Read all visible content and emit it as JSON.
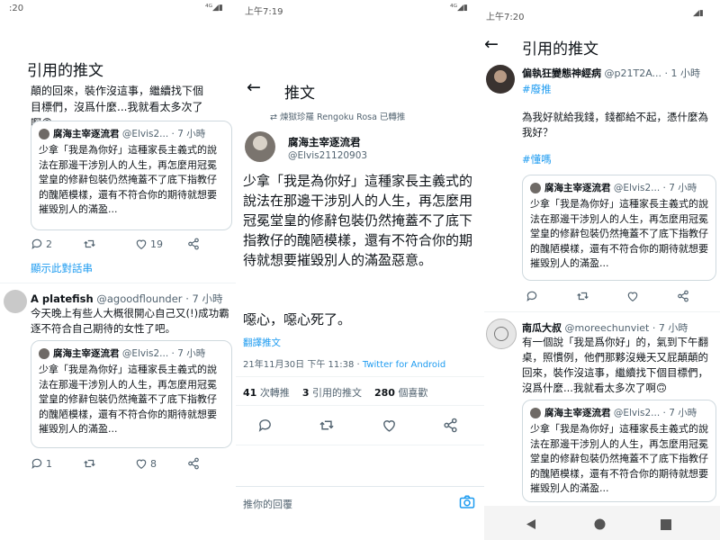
{
  "quote": {
    "name": "腐海主宰逐流君",
    "handle_short": "@Elvis2...",
    "time": "7 小時",
    "text": "少拿「我是為你好」這種家長主義式的說法在那邊干涉別人的人生，再怎麼用冠冕堂皇的修辭包裝仍然掩蓋不了底下指教仔的醜陋模樣，還有不符合你的期待就想要摧毀別人的滿盈..."
  },
  "panel1": {
    "status_time": ":20",
    "header": "引用的推文",
    "top_text": "顛的回來，裝作沒這事，繼續找下個目標們，沒爲什麼...我就看太多次了啊🙃",
    "top_actions": {
      "reply": "2",
      "retweet": "",
      "like": "19"
    },
    "show_thread": "顯示此對話串",
    "tweet2": {
      "name": "A platefish",
      "handle": "@agoodflounder",
      "time": "7 小時",
      "text": "今天晚上有些人大概很開心自己又(!)成功霸逐不符合自己期待的女性了吧。"
    },
    "bottom_actions": {
      "reply": "1",
      "retweet": "",
      "like": "8"
    }
  },
  "panel2": {
    "status_time": "上午7:19",
    "header": "推文",
    "retweeted_by": "煉獄珍羅 Rengoku Rosa 已轉推",
    "name": "腐海主宰逐流君",
    "handle": "@Elvis21120903",
    "text": "少拿「我是為你好」這種家長主義式的說法在那邊干涉別人的人生，再怎麼用冠冕堂皇的修辭包裝仍然掩蓋不了底下指教仔的醜陋模樣，還有不符合你的期待就想要摧毀別人的滿盈惡意。",
    "text2": "噁心，噁心死了。",
    "translate": "翻譯推文",
    "timestamp": "21年11月30日 下午 11:38 · ",
    "source": "Twitter for Android",
    "stats": {
      "retweets_num": "41",
      "retweets_label": "次轉推",
      "quotes_num": "3",
      "quotes_label": "引用的推文",
      "likes_num": "280",
      "likes_label": "個喜歡"
    },
    "reply_placeholder": "推你的回覆"
  },
  "panel3": {
    "status_time": "上午7:20",
    "header": "引用的推文",
    "tweet1": {
      "name": "偏執狂變態神經病",
      "handle": "@p21T2A...",
      "time": "1 小時",
      "hashtag1": "#廢推",
      "text": "為我好就給我錢，錢都給不起，憑什麼為我好？",
      "hashtag2": "#懂嗎"
    },
    "tweet2": {
      "name": "南瓜大叔",
      "handle": "@moreechunviet",
      "time": "7 小時",
      "text": "有一個說「我是爲你好」的，氣到下午翻桌，照慣例，他們那夥沒幾天又屁顛顛的回來，裝作沒這事，繼續找下個目標們，沒爲什麼...我就看太多次了啊🙃"
    }
  },
  "icon_color": "#536471",
  "accent_color": "#1d9bf0"
}
